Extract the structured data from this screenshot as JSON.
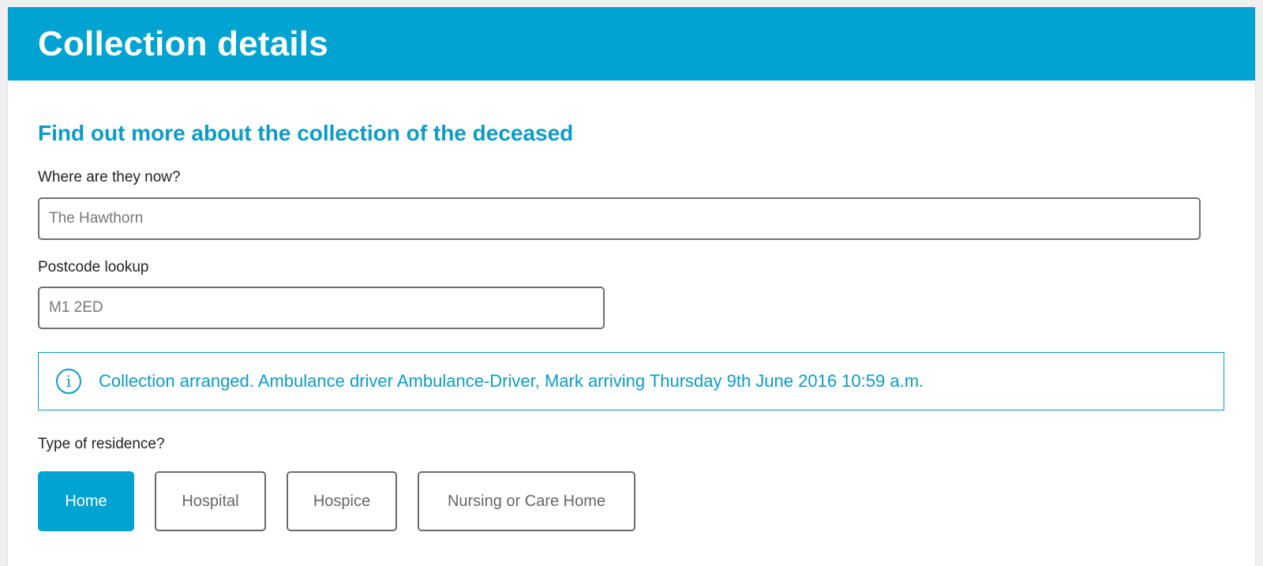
{
  "header": {
    "title": "Collection details"
  },
  "main": {
    "subtitle": "Find out more about the collection of the deceased",
    "location": {
      "label": "Where are they now?",
      "value": "The Hawthorn"
    },
    "postcode": {
      "label": "Postcode lookup",
      "value": "M1 2ED"
    },
    "info": {
      "icon": "info-icon",
      "glyph": "i",
      "message": "Collection arranged. Ambulance driver Ambulance-Driver, Mark arriving Thursday 9th June 2016 10:59 a.m."
    },
    "residence": {
      "label": "Type of residence?",
      "options": [
        {
          "label": "Home",
          "selected": true
        },
        {
          "label": "Hospital",
          "selected": false
        },
        {
          "label": "Hospice",
          "selected": false
        },
        {
          "label": "Nursing or Care Home",
          "selected": false
        }
      ]
    }
  },
  "colors": {
    "brand": "#00a3d1",
    "accent_text": "#0a9cc9"
  }
}
